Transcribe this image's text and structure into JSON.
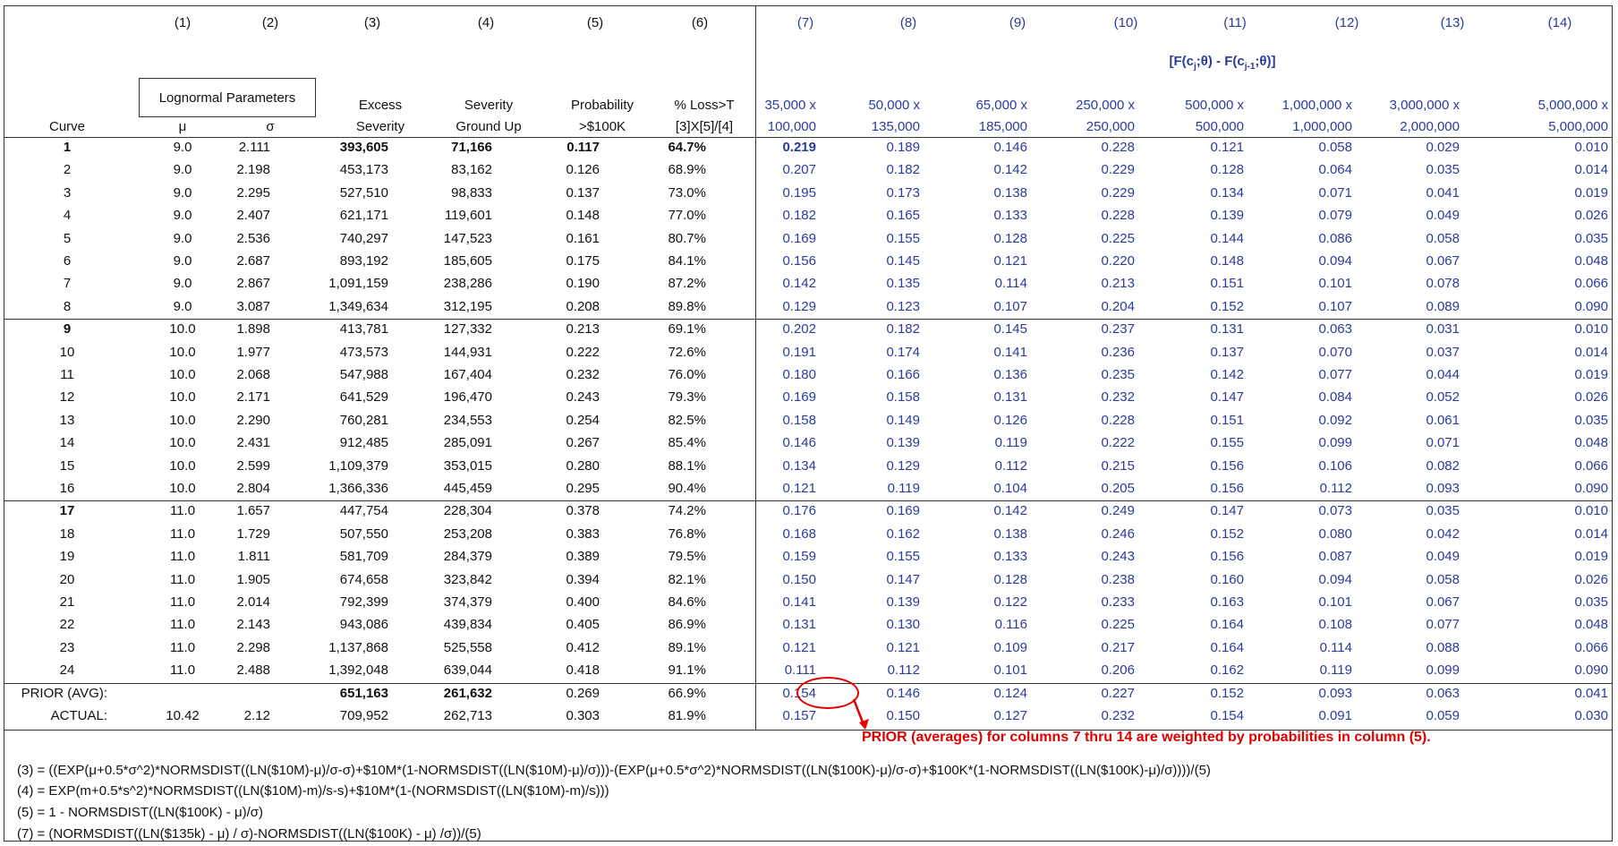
{
  "col_numbers": [
    "(1)",
    "(2)",
    "(3)",
    "(4)",
    "(5)",
    "(6)",
    "(7)",
    "(8)",
    "(9)",
    "(10)",
    "(11)",
    "(12)",
    "(13)",
    "(14)"
  ],
  "header": {
    "lognormal_params": "Lognormal Parameters",
    "curve": "Curve",
    "mu": "μ",
    "sigma": "σ",
    "excess_1": "Excess",
    "excess_2": "Severity",
    "severity_1": "Severity",
    "severity_2": "Ground Up",
    "prob_1": "Probability",
    "prob_2": ">$100K",
    "loss_1": "% Loss>T",
    "loss_2": "[3]X[5]/[4]",
    "bracket_title": "[F(cj;θ) - F(cj-1;θ)]",
    "layers_top": [
      "35,000 x",
      "50,000 x",
      "65,000 x",
      "250,000 x",
      "500,000 x",
      "1,000,000 x",
      "3,000,000 x",
      "5,000,000 x"
    ],
    "layers_bottom": [
      "100,000",
      "135,000",
      "185,000",
      "250,000",
      "500,000",
      "1,000,000",
      "2,000,000",
      "5,000,000"
    ]
  },
  "rows": [
    [
      "1",
      "9.0",
      "2.111",
      "393,605",
      "71,166",
      "0.117",
      "64.7%",
      "0.219",
      "0.189",
      "0.146",
      "0.228",
      "0.121",
      "0.058",
      "0.029",
      "0.010"
    ],
    [
      "2",
      "9.0",
      "2.198",
      "453,173",
      "83,162",
      "0.126",
      "68.9%",
      "0.207",
      "0.182",
      "0.142",
      "0.229",
      "0.128",
      "0.064",
      "0.035",
      "0.014"
    ],
    [
      "3",
      "9.0",
      "2.295",
      "527,510",
      "98,833",
      "0.137",
      "73.0%",
      "0.195",
      "0.173",
      "0.138",
      "0.229",
      "0.134",
      "0.071",
      "0.041",
      "0.019"
    ],
    [
      "4",
      "9.0",
      "2.407",
      "621,171",
      "119,601",
      "0.148",
      "77.0%",
      "0.182",
      "0.165",
      "0.133",
      "0.228",
      "0.139",
      "0.079",
      "0.049",
      "0.026"
    ],
    [
      "5",
      "9.0",
      "2.536",
      "740,297",
      "147,523",
      "0.161",
      "80.7%",
      "0.169",
      "0.155",
      "0.128",
      "0.225",
      "0.144",
      "0.086",
      "0.058",
      "0.035"
    ],
    [
      "6",
      "9.0",
      "2.687",
      "893,192",
      "185,605",
      "0.175",
      "84.1%",
      "0.156",
      "0.145",
      "0.121",
      "0.220",
      "0.148",
      "0.094",
      "0.067",
      "0.048"
    ],
    [
      "7",
      "9.0",
      "2.867",
      "1,091,159",
      "238,286",
      "0.190",
      "87.2%",
      "0.142",
      "0.135",
      "0.114",
      "0.213",
      "0.151",
      "0.101",
      "0.078",
      "0.066"
    ],
    [
      "8",
      "9.0",
      "3.087",
      "1,349,634",
      "312,195",
      "0.208",
      "89.8%",
      "0.129",
      "0.123",
      "0.107",
      "0.204",
      "0.152",
      "0.107",
      "0.089",
      "0.090"
    ],
    [
      "9",
      "10.0",
      "1.898",
      "413,781",
      "127,332",
      "0.213",
      "69.1%",
      "0.202",
      "0.182",
      "0.145",
      "0.237",
      "0.131",
      "0.063",
      "0.031",
      "0.010"
    ],
    [
      "10",
      "10.0",
      "1.977",
      "473,573",
      "144,931",
      "0.222",
      "72.6%",
      "0.191",
      "0.174",
      "0.141",
      "0.236",
      "0.137",
      "0.070",
      "0.037",
      "0.014"
    ],
    [
      "11",
      "10.0",
      "2.068",
      "547,988",
      "167,404",
      "0.232",
      "76.0%",
      "0.180",
      "0.166",
      "0.136",
      "0.235",
      "0.142",
      "0.077",
      "0.044",
      "0.019"
    ],
    [
      "12",
      "10.0",
      "2.171",
      "641,529",
      "196,470",
      "0.243",
      "79.3%",
      "0.169",
      "0.158",
      "0.131",
      "0.232",
      "0.147",
      "0.084",
      "0.052",
      "0.026"
    ],
    [
      "13",
      "10.0",
      "2.290",
      "760,281",
      "234,553",
      "0.254",
      "82.5%",
      "0.158",
      "0.149",
      "0.126",
      "0.228",
      "0.151",
      "0.092",
      "0.061",
      "0.035"
    ],
    [
      "14",
      "10.0",
      "2.431",
      "912,485",
      "285,091",
      "0.267",
      "85.4%",
      "0.146",
      "0.139",
      "0.119",
      "0.222",
      "0.155",
      "0.099",
      "0.071",
      "0.048"
    ],
    [
      "15",
      "10.0",
      "2.599",
      "1,109,379",
      "353,015",
      "0.280",
      "88.1%",
      "0.134",
      "0.129",
      "0.112",
      "0.215",
      "0.156",
      "0.106",
      "0.082",
      "0.066"
    ],
    [
      "16",
      "10.0",
      "2.804",
      "1,366,336",
      "445,459",
      "0.295",
      "90.4%",
      "0.121",
      "0.119",
      "0.104",
      "0.205",
      "0.156",
      "0.112",
      "0.093",
      "0.090"
    ],
    [
      "17",
      "11.0",
      "1.657",
      "447,754",
      "228,304",
      "0.378",
      "74.2%",
      "0.176",
      "0.169",
      "0.142",
      "0.249",
      "0.147",
      "0.073",
      "0.035",
      "0.010"
    ],
    [
      "18",
      "11.0",
      "1.729",
      "507,550",
      "253,208",
      "0.383",
      "76.8%",
      "0.168",
      "0.162",
      "0.138",
      "0.246",
      "0.152",
      "0.080",
      "0.042",
      "0.014"
    ],
    [
      "19",
      "11.0",
      "1.811",
      "581,709",
      "284,379",
      "0.389",
      "79.5%",
      "0.159",
      "0.155",
      "0.133",
      "0.243",
      "0.156",
      "0.087",
      "0.049",
      "0.019"
    ],
    [
      "20",
      "11.0",
      "1.905",
      "674,658",
      "323,842",
      "0.394",
      "82.1%",
      "0.150",
      "0.147",
      "0.128",
      "0.238",
      "0.160",
      "0.094",
      "0.058",
      "0.026"
    ],
    [
      "21",
      "11.0",
      "2.014",
      "792,399",
      "374,379",
      "0.400",
      "84.6%",
      "0.141",
      "0.139",
      "0.122",
      "0.233",
      "0.163",
      "0.101",
      "0.067",
      "0.035"
    ],
    [
      "22",
      "11.0",
      "2.143",
      "943,086",
      "439,834",
      "0.405",
      "86.9%",
      "0.131",
      "0.130",
      "0.116",
      "0.225",
      "0.164",
      "0.108",
      "0.077",
      "0.048"
    ],
    [
      "23",
      "11.0",
      "2.298",
      "1,137,868",
      "525,558",
      "0.412",
      "89.1%",
      "0.121",
      "0.121",
      "0.109",
      "0.217",
      "0.164",
      "0.114",
      "0.088",
      "0.066"
    ],
    [
      "24",
      "11.0",
      "2.488",
      "1,392,048",
      "639,044",
      "0.418",
      "91.1%",
      "0.111",
      "0.112",
      "0.101",
      "0.206",
      "0.162",
      "0.119",
      "0.099",
      "0.090"
    ]
  ],
  "prior": [
    "PRIOR (AVG):",
    "",
    "",
    "651,163",
    "261,632",
    "0.269",
    "66.9%",
    "0.154",
    "0.146",
    "0.124",
    "0.227",
    "0.152",
    "0.093",
    "0.063",
    "0.041"
  ],
  "actual": [
    "ACTUAL:",
    "10.42",
    "2.12",
    "709,952",
    "262,713",
    "0.303",
    "81.9%",
    "0.157",
    "0.150",
    "0.127",
    "0.232",
    "0.154",
    "0.091",
    "0.059",
    "0.030"
  ],
  "note": "PRIOR (averages) for columns 7 thru 14 are weighted by probabilities in column (5).",
  "formulas": [
    "(3) = ((EXP(μ+0.5*σ^2)*NORMSDIST((LN($10M)-μ)/σ-σ)+$10M*(1-NORMSDIST((LN($10M)-μ)/σ)))-(EXP(μ+0.5*σ^2)*NORMSDIST((LN($100K)-μ)/σ-σ)+$100K*(1-NORMSDIST((LN($100K)-μ)/σ))))/(5)",
    "(4) = EXP(m+0.5*s^2)*NORMSDIST((LN($10M)-m)/s-s)+$10M*(1-(NORMSDIST((LN($10M)-m)/s)))",
    "(5) = 1 - NORMSDIST((LN($100K) - μ)/σ)",
    "(7) = (NORMSDIST((LN($135k) - μ) / σ)-NORMSDIST((LN($100K) - μ) /σ))/(5)"
  ],
  "colors": {
    "accent_blue": "#2b3a9c",
    "annotation_red": "#e00000"
  }
}
